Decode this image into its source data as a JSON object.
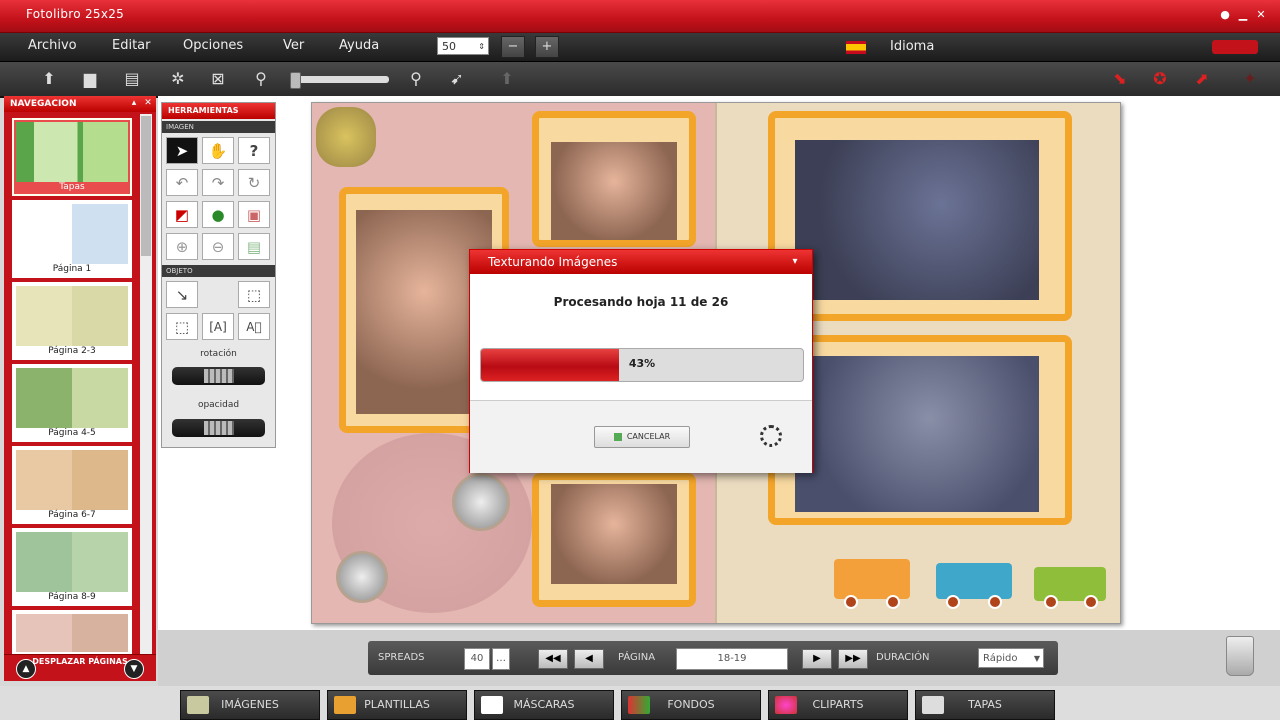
{
  "window": {
    "title": "Fotolibro 25x25"
  },
  "menubar": {
    "items": [
      "Archivo",
      "Editar",
      "Opciones",
      "Ver",
      "Ayuda"
    ],
    "zoom_value": "50",
    "language_label": "Idioma"
  },
  "navigation": {
    "header": "NAVEGACION",
    "pages": [
      {
        "label": "Tapas"
      },
      {
        "label": "Página 1"
      },
      {
        "label": "Página 2-3"
      },
      {
        "label": "Página 4-5"
      },
      {
        "label": "Página 6-7"
      },
      {
        "label": "Página 8-9"
      }
    ],
    "bottom_button": "DESPLAZAR PÁGINAS"
  },
  "tools": {
    "header": "HERRAMIENTAS",
    "section_1": "IMAGEN",
    "section_2": "OBJETO",
    "rotation_label": "rotación",
    "opacity_label": "opacidad"
  },
  "modal": {
    "title": "Texturando Imágenes",
    "message": "Procesando hoja 11 de 26",
    "progress_text": "43%",
    "progress": 0.43,
    "cancel_label": "CANCELAR"
  },
  "page_nav": {
    "spreads_label": "SPREADS",
    "spreads_value": "40",
    "page_label": "PÁGINA",
    "page_value": "18-19",
    "duration_label": "DURACIÓN",
    "duration_value": "Rápido"
  },
  "tabs": [
    "IMÁGENES",
    "PLANTILLAS",
    "MÁSCARAS",
    "FONDOS",
    "CLIPARTS",
    "TAPAS"
  ],
  "colors": {
    "accent": "#c4121b",
    "dark": "#2b2b2b"
  }
}
